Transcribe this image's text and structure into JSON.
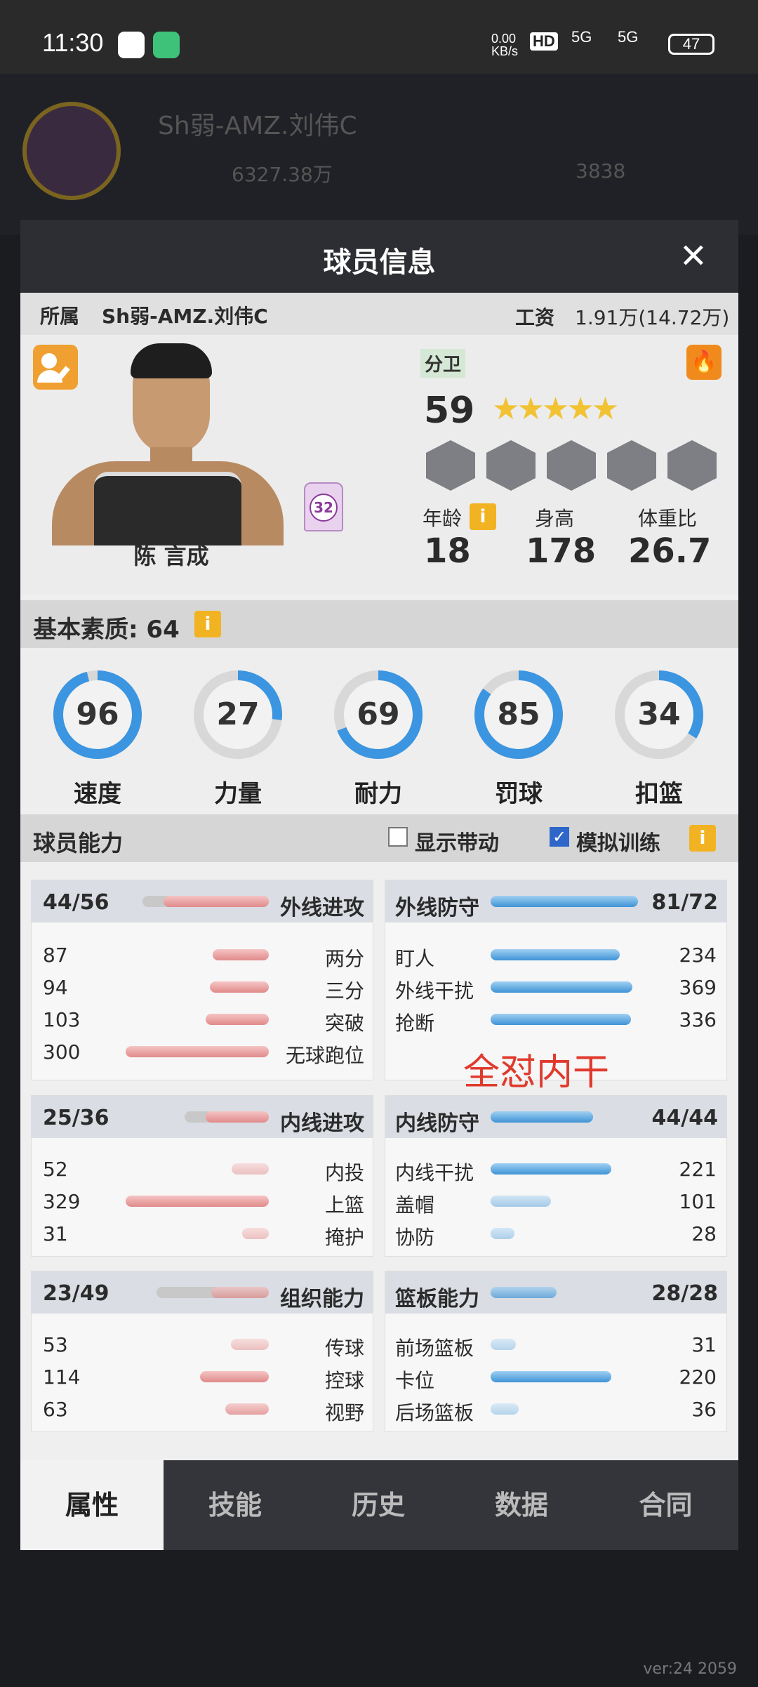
{
  "status_bar": {
    "time": "11:30",
    "net_speed": "0.00\nKB/s",
    "hd": "HD",
    "sig1": "5G",
    "sig2": "5G",
    "battery": "47"
  },
  "background": {
    "team_name": "Sh弱-AMZ.刘伟C",
    "currency1": "6327.38万",
    "currency2": "3838",
    "version": "ver:24  2059"
  },
  "modal": {
    "title": "球员信息",
    "close": "✕",
    "affiliation_label": "所属",
    "affiliation_value": "Sh弱-AMZ.刘伟C",
    "salary_label": "工资",
    "salary_value": "1.91万(14.72万)",
    "player": {
      "name": "陈 言成",
      "jersey": "32",
      "position": "分卫",
      "overall": "59",
      "stars": 4.5,
      "age_label": "年龄",
      "age": "18",
      "height_label": "身高",
      "height": "178",
      "weight_label": "体重比",
      "weight": "26.7"
    },
    "basic_label": "基本素质: 64",
    "attributes": [
      {
        "label": "速度",
        "value": "96"
      },
      {
        "label": "力量",
        "value": "27"
      },
      {
        "label": "耐力",
        "value": "69"
      },
      {
        "label": "罚球",
        "value": "85"
      },
      {
        "label": "扣篮",
        "value": "34"
      }
    ],
    "ability_label": "球员能力",
    "show_band_label": "显示带动",
    "show_band_checked": false,
    "sim_train_label": "模拟训练",
    "sim_train_checked": true,
    "annotation": "全怼内干",
    "cards": {
      "outside_attack": {
        "title": "外线进攻",
        "score": "44/56",
        "rows": [
          {
            "label": "两分",
            "value": "87"
          },
          {
            "label": "三分",
            "value": "94"
          },
          {
            "label": "突破",
            "value": "103"
          },
          {
            "label": "无球跑位",
            "value": "300"
          }
        ]
      },
      "outside_defense": {
        "title": "外线防守",
        "score": "81/72",
        "rows": [
          {
            "label": "盯人",
            "value": "234"
          },
          {
            "label": "外线干扰",
            "value": "369"
          },
          {
            "label": "抢断",
            "value": "336"
          }
        ]
      },
      "inside_attack": {
        "title": "内线进攻",
        "score": "25/36",
        "rows": [
          {
            "label": "内投",
            "value": "52"
          },
          {
            "label": "上篮",
            "value": "329"
          },
          {
            "label": "掩护",
            "value": "31"
          }
        ]
      },
      "inside_defense": {
        "title": "内线防守",
        "score": "44/44",
        "rows": [
          {
            "label": "内线干扰",
            "value": "221"
          },
          {
            "label": "盖帽",
            "value": "101"
          },
          {
            "label": "协防",
            "value": "28"
          }
        ]
      },
      "playmaking": {
        "title": "组织能力",
        "score": "23/49",
        "rows": [
          {
            "label": "传球",
            "value": "53"
          },
          {
            "label": "控球",
            "value": "114"
          },
          {
            "label": "视野",
            "value": "63"
          }
        ]
      },
      "rebound": {
        "title": "篮板能力",
        "score": "28/28",
        "rows": [
          {
            "label": "前场篮板",
            "value": "31"
          },
          {
            "label": "卡位",
            "value": "220"
          },
          {
            "label": "后场篮板",
            "value": "36"
          }
        ]
      }
    },
    "tabs": [
      "属性",
      "技能",
      "历史",
      "数据",
      "合同"
    ]
  }
}
